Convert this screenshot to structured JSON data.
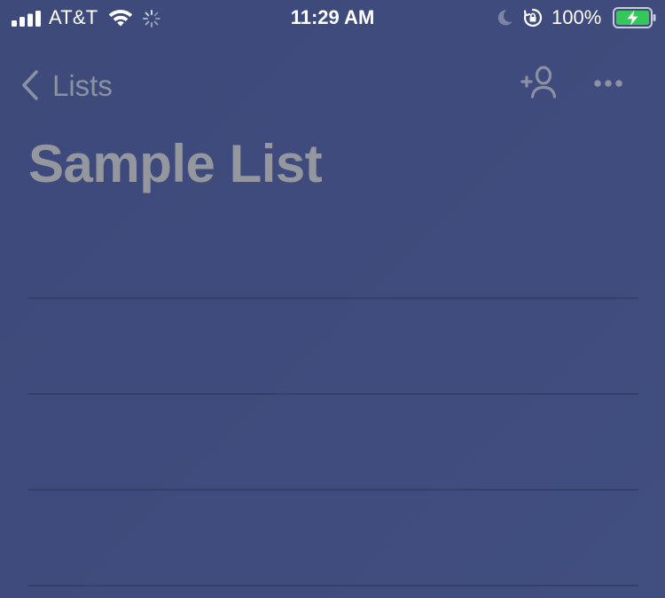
{
  "status_bar": {
    "carrier": "AT&T",
    "time": "11:29 AM",
    "battery_percent": "100%",
    "icons": [
      "signal-bars-icon",
      "wifi-icon",
      "activity-spinner-icon",
      "moon-icon",
      "rotation-lock-icon",
      "battery-charging-icon"
    ],
    "battery_color": "#34c759"
  },
  "nav": {
    "back_label": "Lists",
    "back_icon": "chevron-left-icon",
    "share_icon": "add-person-icon",
    "more_icon": "ellipsis-icon"
  },
  "page": {
    "title": "Sample List"
  },
  "list": {
    "rows": [
      {
        "text": ""
      },
      {
        "text": ""
      },
      {
        "text": ""
      },
      {
        "text": ""
      }
    ]
  },
  "colors": {
    "background": "#3f4b7c",
    "muted_text": "#8b91a3",
    "title_text": "#95979f",
    "separator": "#363f6a"
  }
}
